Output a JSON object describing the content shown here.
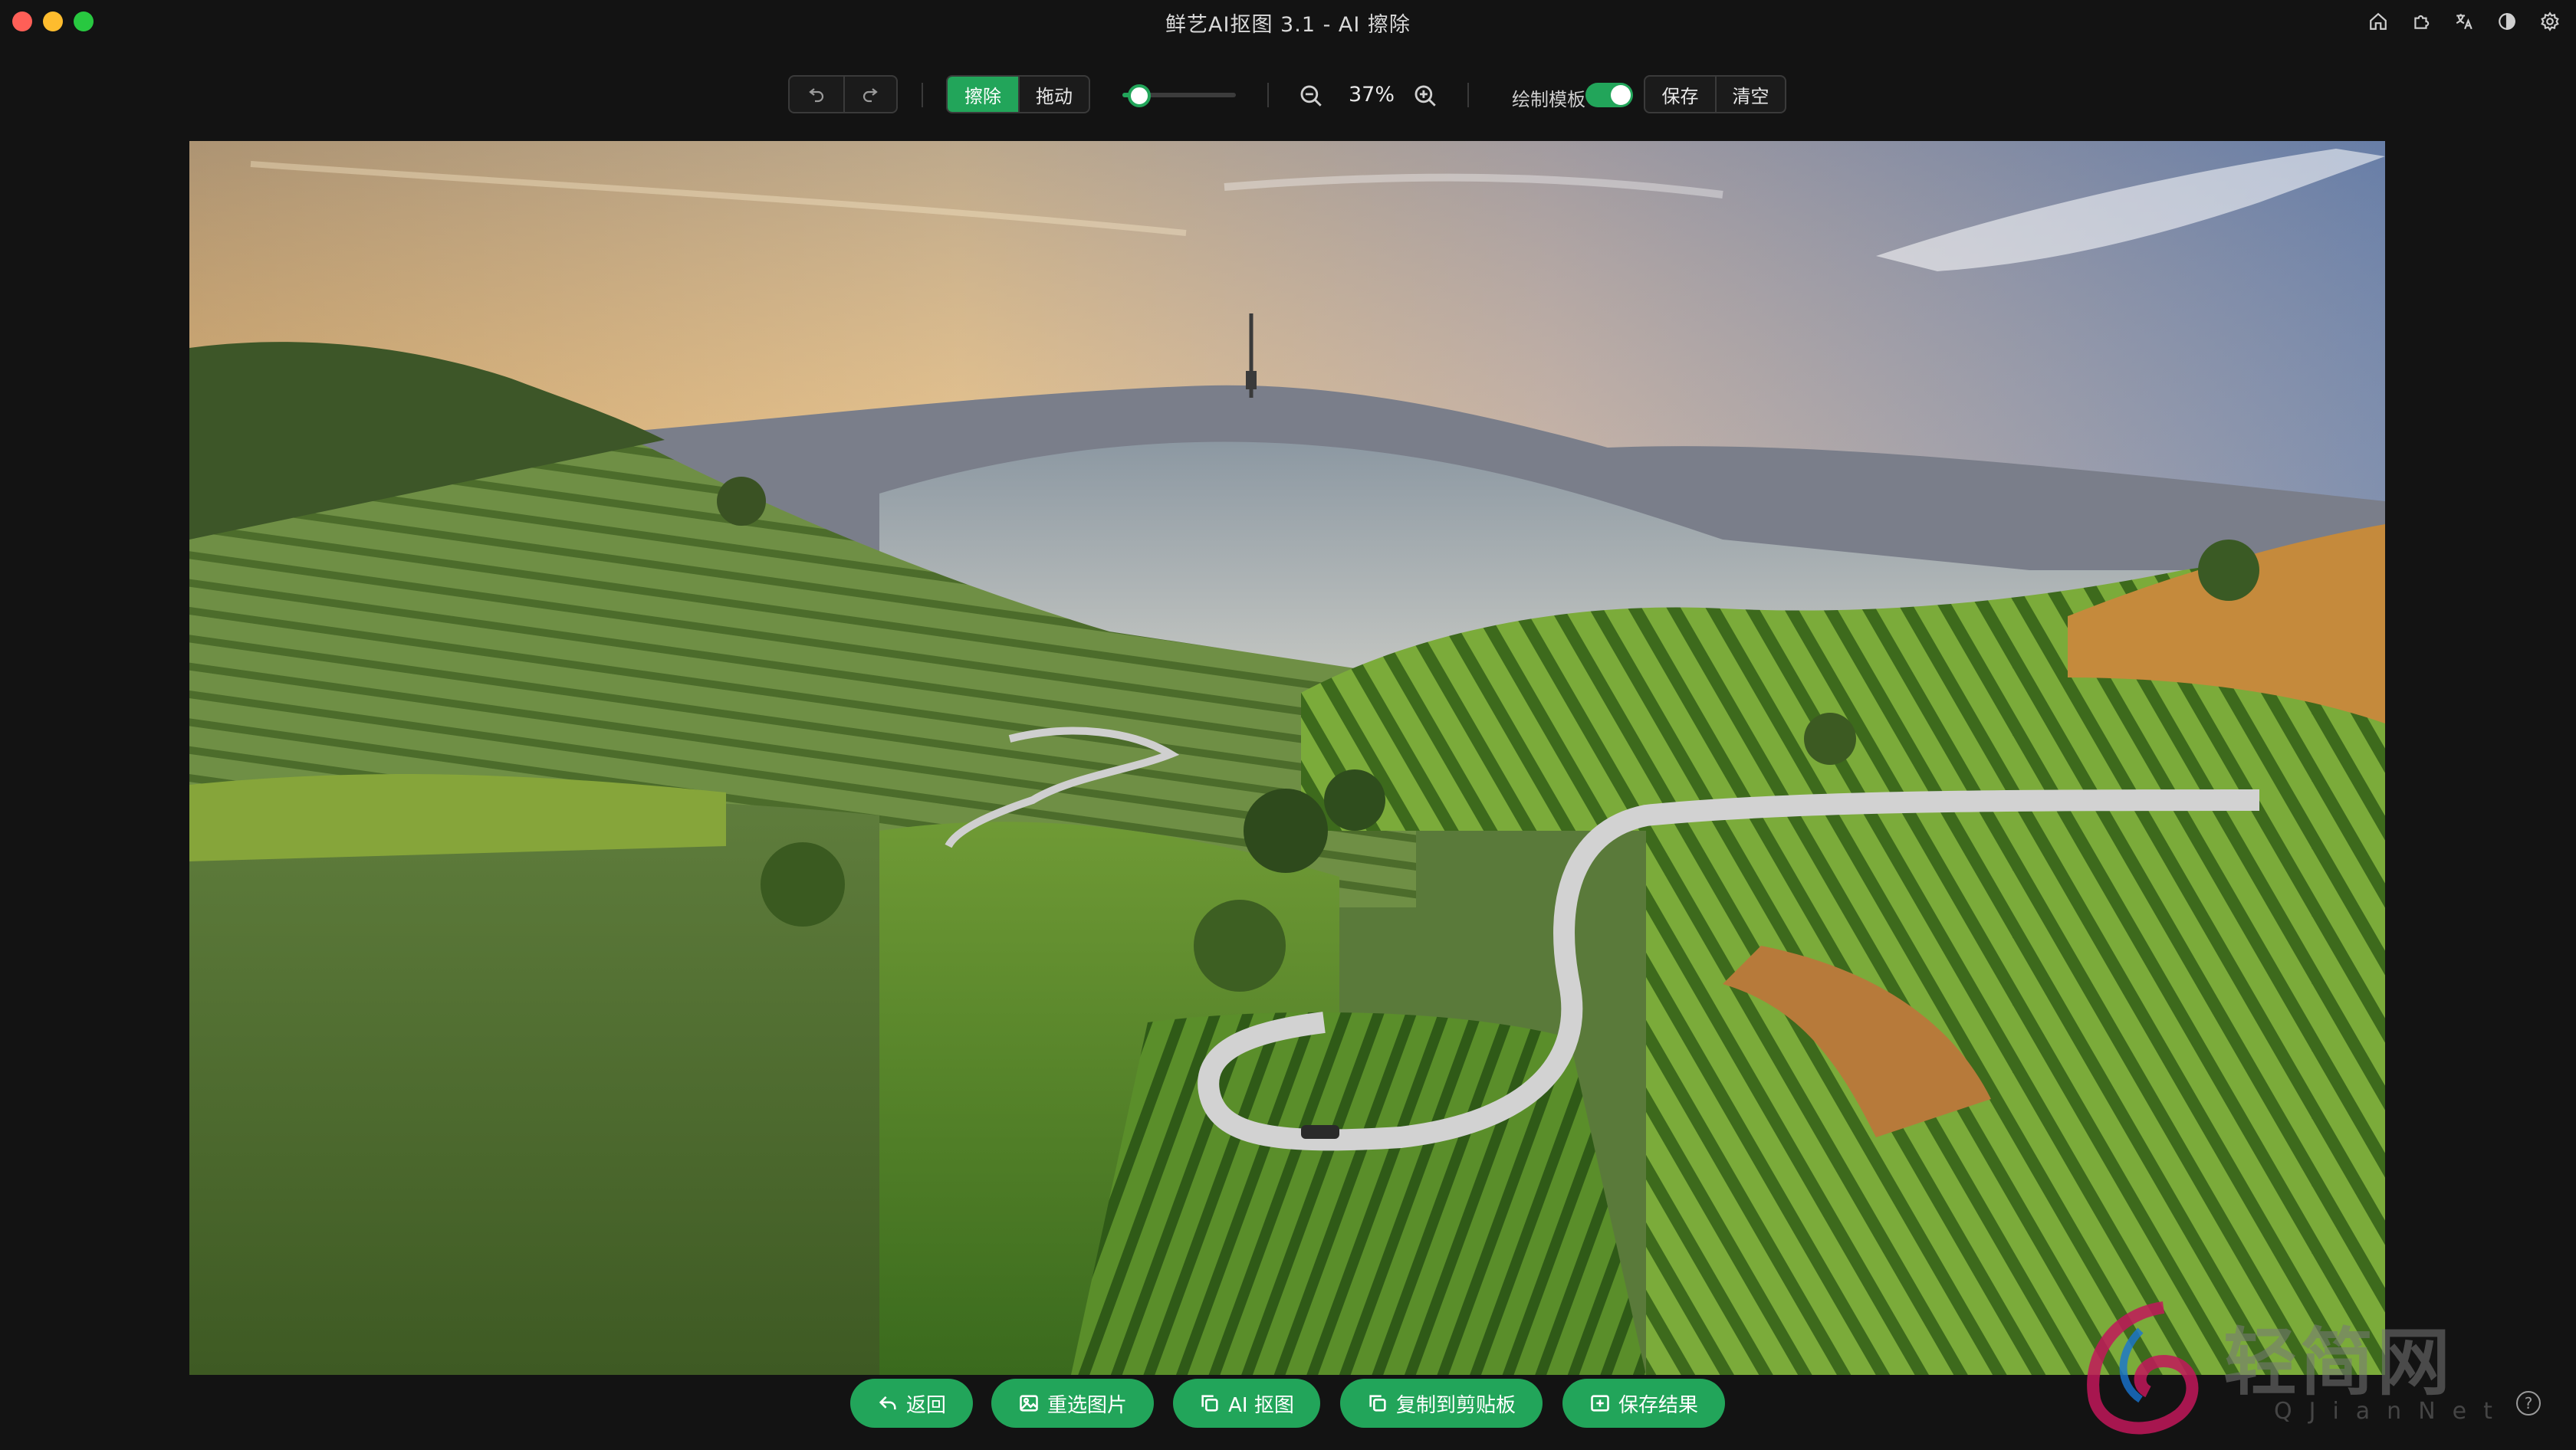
{
  "window": {
    "title": "鲜艺AI抠图 3.1 - AI 擦除",
    "title_icons": [
      "home-icon",
      "extension-icon",
      "translate-icon",
      "theme-icon",
      "settings-icon"
    ]
  },
  "toolbar": {
    "undo_icon": "undo-icon",
    "redo_icon": "redo-icon",
    "mode_erase": "擦除",
    "mode_drag": "拖动",
    "active_mode": "擦除",
    "brush_size_fraction": 0.12,
    "zoom_value": "37%",
    "template_label": "绘制模板",
    "template_enabled": true,
    "save_label": "保存",
    "clear_label": "清空"
  },
  "bottom": {
    "back": "返回",
    "reselect": "重选图片",
    "ai_cutout": "AI 抠图",
    "copy_clipboard": "复制到剪贴板",
    "save_result": "保存结果",
    "help": "?"
  },
  "watermark": {
    "text": "轻简网",
    "sub": "QJianNet"
  },
  "colors": {
    "accent": "#22a55a",
    "background": "#131313"
  }
}
